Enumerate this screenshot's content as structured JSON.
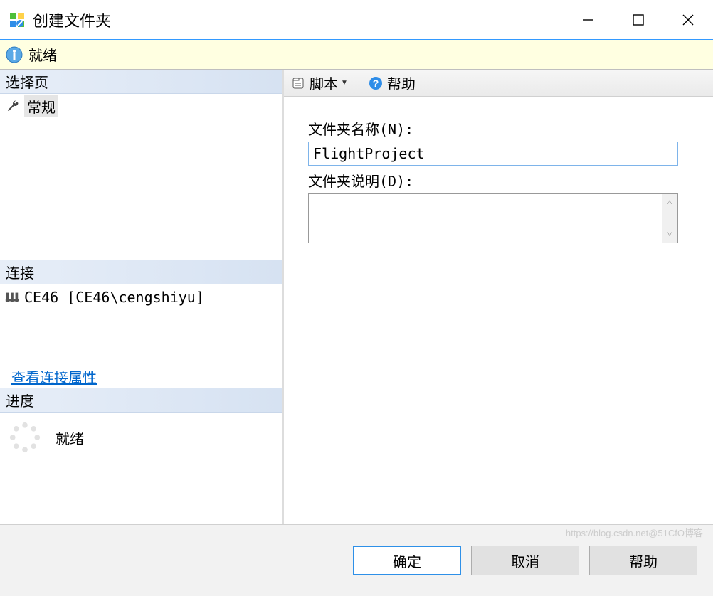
{
  "window": {
    "title": "创建文件夹"
  },
  "status": {
    "text": "就绪"
  },
  "left": {
    "select_page": "选择页",
    "general": "常规",
    "connection": "连接",
    "conn_value": "CE46 [CE46\\cengshiyu]",
    "view_props": "查看连接属性",
    "progress": "进度",
    "progress_status": "就绪"
  },
  "toolbar": {
    "script": "脚本",
    "help": "帮助"
  },
  "form": {
    "name_label": "文件夹名称(N):",
    "name_value": "FlightProject",
    "desc_label": "文件夹说明(D):",
    "desc_value": ""
  },
  "buttons": {
    "ok": "确定",
    "cancel": "取消",
    "help": "帮助"
  },
  "watermark": "https://blog.csdn.net@51CfO博客"
}
